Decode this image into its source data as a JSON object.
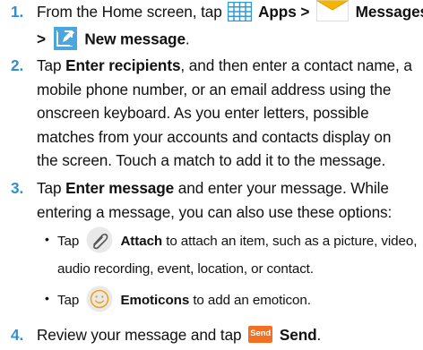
{
  "colors": {
    "step_number": "#2f8fcf",
    "apps_icon": "#2f9ad8",
    "messages_icon_top": "#f6b400",
    "new_message_icon": "#4aa6dc",
    "emoticon_icon": "#f3a018",
    "send_icon": "#f37021"
  },
  "steps": [
    {
      "number": "1.",
      "intro": "From the Home screen, tap",
      "apps": "Apps >",
      "messages": "Messages",
      "gt": ">",
      "new_message": "New message",
      "end": "."
    },
    {
      "number": "2.",
      "tap": "Tap",
      "bold": "Enter recipients",
      "line1_rest": ", and then enter a contact name, a",
      "line2": "mobile phone number, or an email address using the",
      "line3": "onscreen keyboard. As you enter letters, possible",
      "line4": "matches from your accounts and contacts display on",
      "line5": "the screen. Touch a match to add it to the message."
    },
    {
      "number": "3.",
      "tap": "Tap",
      "bold": "Enter message",
      "line1_rest": "and enter your message. While",
      "line2": "entering a message, you can also use these options:",
      "options": [
        {
          "bullet": "•",
          "tap": "Tap",
          "icon": "paperclip-icon",
          "bold": "Attach",
          "line1_rest": "to attach an item, such as a picture, video,",
          "line2": "audio recording, event, location, or contact."
        },
        {
          "bullet": "•",
          "tap": "Tap",
          "icon": "smiley-icon",
          "bold": "Emoticons",
          "line1_rest": "to add an emoticon."
        }
      ]
    },
    {
      "number": "4.",
      "intro": "Review your message and tap",
      "send_icon_label": "Send",
      "bold": "Send",
      "end": "."
    }
  ]
}
